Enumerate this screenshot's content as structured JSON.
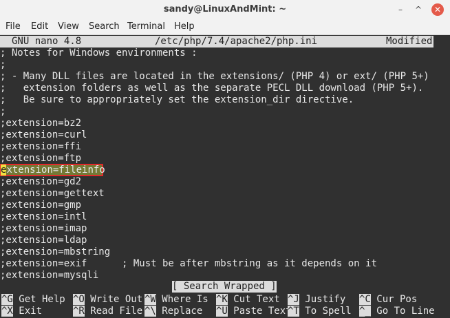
{
  "window": {
    "title": "sandy@LinuxAndMint: ~",
    "min_glyph": "–",
    "max_glyph": "^",
    "close_glyph": "✕"
  },
  "menu": [
    "File",
    "Edit",
    "View",
    "Search",
    "Terminal",
    "Help"
  ],
  "nano": {
    "version": "GNU nano 4.8",
    "filename": "/etc/php/7.4/apache2/php.ini",
    "state": "Modified",
    "status_message": "[ Search Wrapped ]"
  },
  "lines": [
    "; Notes for Windows environments :",
    ";",
    "; - Many DLL files are located in the extensions/ (PHP 4) or ext/ (PHP 5+)",
    ";   extension folders as well as the separate PECL DLL download (PHP 5+).",
    ";   Be sure to appropriately set the extension_dir directive.",
    ";",
    ";extension=bz2",
    ";extension=curl",
    ";extension=ffi",
    ";extension=ftp",
    "extension=fileinfo",
    ";extension=gd2",
    ";extension=gettext",
    ";extension=gmp",
    ";extension=intl",
    ";extension=imap",
    ";extension=ldap",
    ";extension=mbstring",
    ";extension=exif      ; Must be after mbstring as it depends on it",
    ";extension=mysqli"
  ],
  "cursor_line": {
    "cursor_char": "e",
    "rest": "xtension=fileinfo"
  },
  "shortcuts": [
    {
      "key": "^G",
      "label": " Get Help"
    },
    {
      "key": "^O",
      "label": " Write Out"
    },
    {
      "key": "^W",
      "label": " Where Is"
    },
    {
      "key": "^K",
      "label": " Cut Text"
    },
    {
      "key": "^J",
      "label": " Justify"
    },
    {
      "key": "^C",
      "label": " Cur Pos"
    },
    {
      "key": "^X",
      "label": " Exit"
    },
    {
      "key": "^R",
      "label": " Read File"
    },
    {
      "key": "^\\",
      "label": " Replace"
    },
    {
      "key": "^U",
      "label": " Paste Text"
    },
    {
      "key": "^T",
      "label": " To Spell"
    },
    {
      "key": "^_",
      "label": " Go To Line"
    }
  ],
  "colors": {
    "terminal_bg": "#303030",
    "highlight_border": "#e22a2a",
    "cursor": "#f0e040"
  }
}
